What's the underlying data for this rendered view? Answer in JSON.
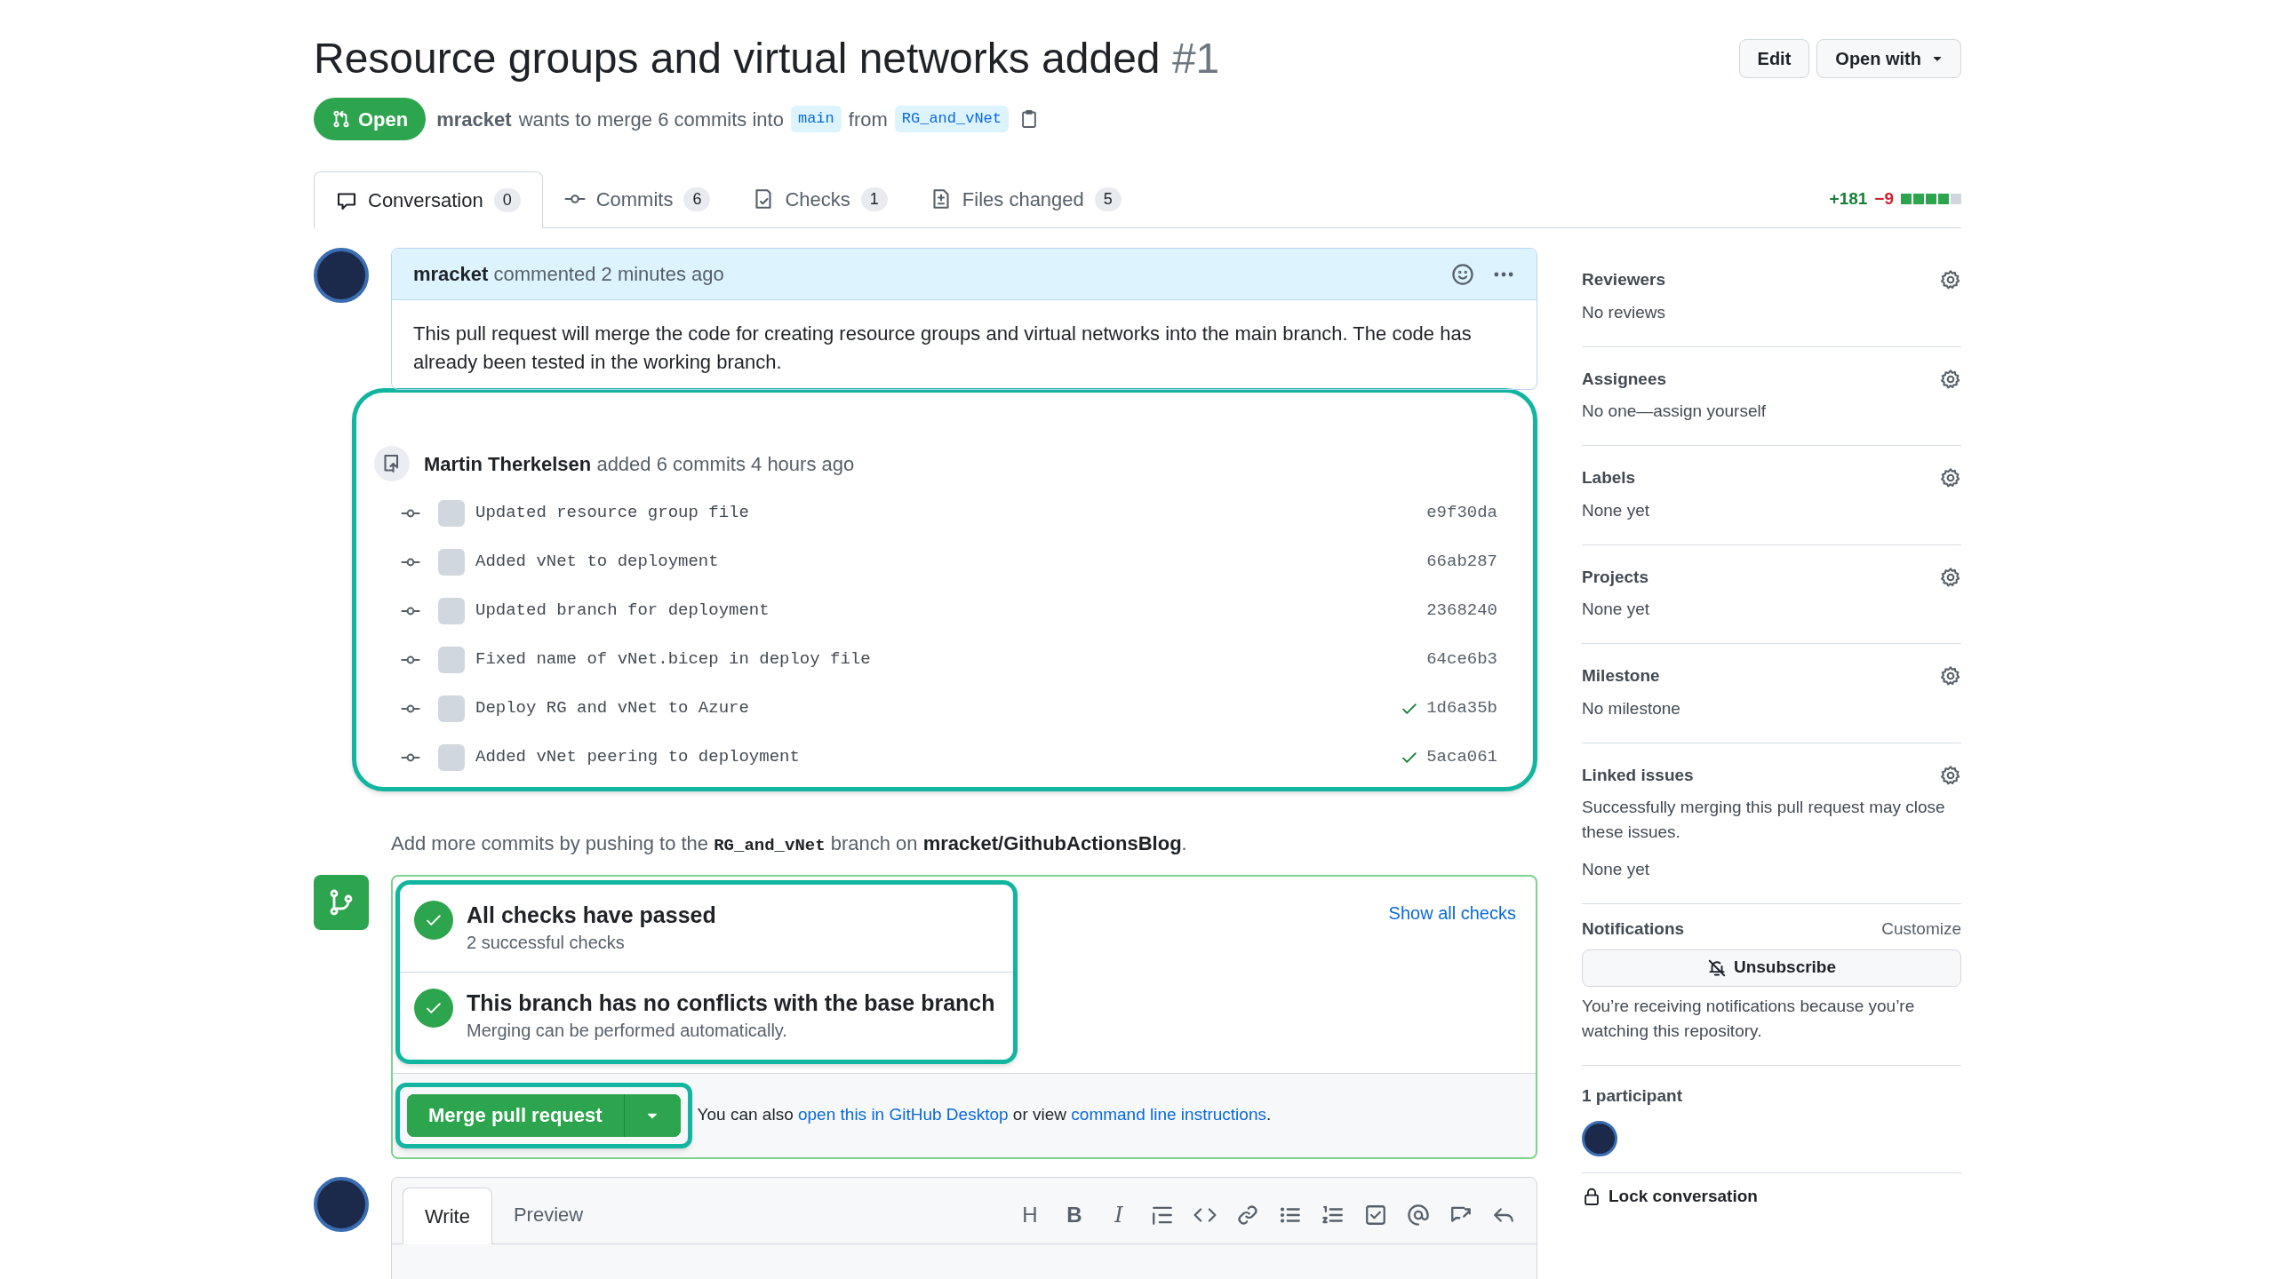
{
  "title": "Resource groups and virtual networks added",
  "number": "#1",
  "header_buttons": [
    {
      "label": "Edit",
      "dropdown": false
    },
    {
      "label": "Open with",
      "dropdown": true
    }
  ],
  "state": {
    "label": "Open",
    "kind": "open"
  },
  "summary": {
    "author": "mracket",
    "text": "wants to merge 6 commits into",
    "base": "main",
    "from_text": "from",
    "head": "RG_and_vNet"
  },
  "tabs": [
    {
      "label": "Conversation",
      "count": "0",
      "selected": true
    },
    {
      "label": "Commits",
      "count": "6",
      "selected": false
    },
    {
      "label": "Checks",
      "count": "1",
      "selected": false
    },
    {
      "label": "Files changed",
      "count": "5",
      "selected": false
    }
  ],
  "diffstat": {
    "added": "+181",
    "removed": "−9",
    "level": 0.8
  },
  "comment": {
    "author": "mracket",
    "meta": "commented 2 minutes ago",
    "body": "This pull request will merge the code for creating resource groups and virtual networks into the main branch. The code has already been tested in the working branch."
  },
  "commit_group": {
    "author": "Martin Therkelsen",
    "meta": "added 6 commits 4 hours ago",
    "commits": [
      {
        "message": "Updated resource group file",
        "sha": "e9f30da",
        "checked": false
      },
      {
        "message": "Added vNet to deployment",
        "sha": "66ab287",
        "checked": false
      },
      {
        "message": "Updated branch for deployment",
        "sha": "2368240",
        "checked": false
      },
      {
        "message": "Fixed name of vNet.bicep in deploy file",
        "sha": "64ce6b3",
        "checked": false
      },
      {
        "message": "Deploy RG and vNet to Azure",
        "sha": "1d6a35b",
        "checked": true
      },
      {
        "message": "Added vNet peering to deployment",
        "sha": "5aca061",
        "checked": true
      }
    ]
  },
  "push_note": {
    "before": "Add more commits by pushing to the",
    "branch": "RG_and_vNet",
    "middle": "branch on",
    "repo": "mracket/GithubActionsBlog",
    "after": "."
  },
  "merge_box": {
    "show_all": "Show all checks",
    "checks": [
      {
        "title": "All checks have passed",
        "subtitle": "2 successful checks",
        "passed": true
      },
      {
        "title": "This branch has no conflicts with the base branch",
        "subtitle": "Merging can be performed automatically.",
        "passed": true
      }
    ],
    "merge_button": "Merge pull request",
    "note": {
      "before": "You can also",
      "link1": "open this in GitHub Desktop",
      "middle": "or view",
      "link2": "command line instructions",
      "after": "."
    }
  },
  "editor": {
    "tabs": [
      {
        "label": "Write",
        "selected": true
      },
      {
        "label": "Preview",
        "selected": false
      }
    ],
    "toolbar_letters": [
      "H",
      "B",
      "I"
    ]
  },
  "sidebar": {
    "sections": [
      {
        "title": "Reviewers",
        "lines": [
          "No reviews"
        ]
      },
      {
        "title": "Assignees",
        "lines": [
          "No one—assign yourself"
        ]
      },
      {
        "title": "Labels",
        "lines": [
          "None yet"
        ]
      },
      {
        "title": "Projects",
        "lines": [
          "None yet"
        ]
      },
      {
        "title": "Milestone",
        "lines": [
          "No milestone"
        ]
      },
      {
        "title": "Linked issues",
        "lines": [
          "Successfully merging this pull request may close these issues.",
          "None yet"
        ]
      }
    ],
    "notifications": {
      "title": "Notifications",
      "customize": "Customize",
      "button": "Unsubscribe",
      "note": "You’re receiving notifications because you’re watching this repository."
    },
    "participants": {
      "title": "1 participant"
    },
    "lock": "Lock conversation"
  }
}
